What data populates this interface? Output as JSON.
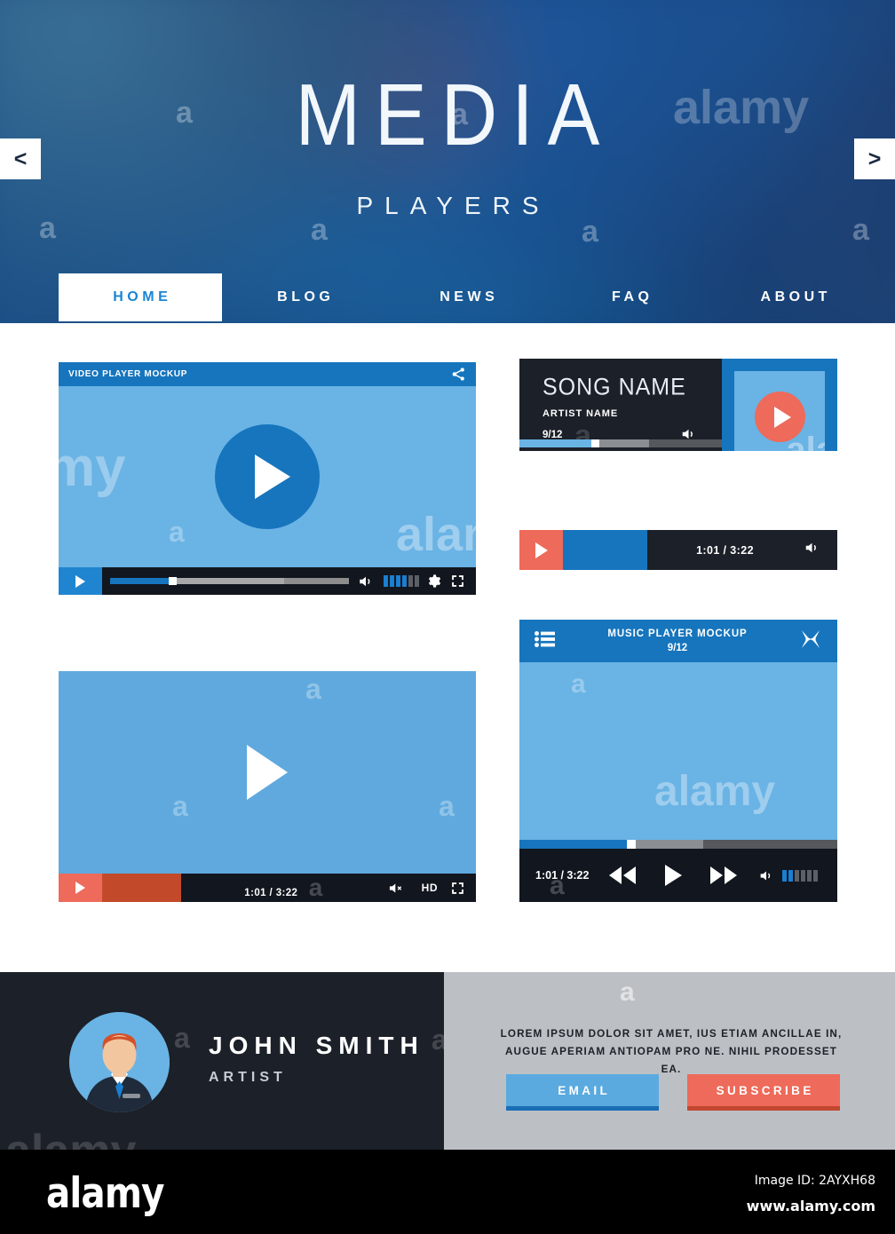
{
  "hero": {
    "title": "MEDIA",
    "subtitle": "PLAYERS",
    "prev_arrow": "<",
    "next_arrow": ">"
  },
  "nav": {
    "items": [
      {
        "label": "HOME",
        "active": true
      },
      {
        "label": "BLOG",
        "active": false
      },
      {
        "label": "NEWS",
        "active": false
      },
      {
        "label": "FAQ",
        "active": false
      },
      {
        "label": "ABOUT",
        "active": false
      }
    ]
  },
  "video_player_1": {
    "title": "VIDEO PLAYER MOCKUP",
    "share_icon": "share-icon",
    "play_icon": "play-icon",
    "settings_icon": "gear-icon",
    "fullscreen_icon": "fullscreen-icon",
    "volume_icon": "volume-icon",
    "progress_percent": 26,
    "buffered_percent": 73,
    "volume_level": 4,
    "volume_total": 6
  },
  "video_player_2": {
    "play_icon": "play-icon",
    "time": "1:01 / 3:22",
    "mute_icon": "volume-mute-icon",
    "hd_label": "HD",
    "fullscreen_icon": "fullscreen-icon",
    "progress_percent": 19
  },
  "song_card": {
    "song_name": "SONG NAME",
    "artist_name": "ARTIST NAME",
    "track_count": "9/12",
    "volume_icon": "volume-icon",
    "play_icon": "play-icon",
    "album_art": "album-art",
    "progress_percent": 36
  },
  "audio_bar": {
    "play_icon": "play-icon",
    "time": "1:01 / 3:22",
    "volume_icon": "volume-icon",
    "progress_percent": 27
  },
  "music_player": {
    "title": "MUSIC PLAYER MOCKUP",
    "track_count": "9/12",
    "playlist_icon": "playlist-icon",
    "shuffle_icon": "shuffle-icon",
    "time": "1:01 / 3:22",
    "rewind_icon": "rewind-icon",
    "play_icon": "play-icon",
    "forward_icon": "fast-forward-icon",
    "volume_icon": "volume-icon",
    "volume_level": 2,
    "volume_total": 6,
    "progress_percent": 34
  },
  "footer": {
    "profile_name": "JOHN SMITH",
    "profile_role": "ARTIST",
    "avatar": "user-avatar",
    "cta_text": "LOREM IPSUM DOLOR SIT AMET, IUS ETIAM ANCILLAE IN, AUGUE APERIAM ANTIOPAM PRO NE. NIHIL PRODESSET EA.",
    "email_button": "EMAIL",
    "subscribe_button": "SUBSCRIBE"
  },
  "stock_bar": {
    "logo": "alamy",
    "image_id": "Image ID: 2AYXH68",
    "url": "www.alamy.com"
  },
  "watermarks": {
    "a": "a",
    "alamy": "alamy",
    "my": "my",
    "alam": "alam",
    "ala": "ala"
  },
  "colors": {
    "accent_blue": "#1675bd",
    "light_blue": "#6ab3e5",
    "dark": "#1c2028",
    "red": "#ee6a5a",
    "grey": "#bcc0c4"
  }
}
